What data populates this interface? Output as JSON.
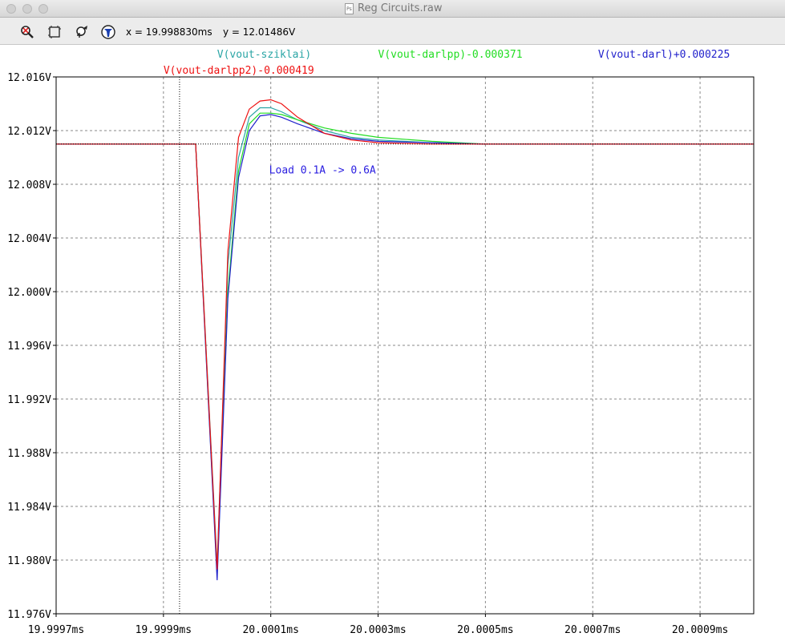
{
  "window": {
    "title": "Reg Circuits.raw",
    "file_icon": "Ps"
  },
  "toolbar": {
    "tools": [
      "zoom-out-icon",
      "zoom-full-icon",
      "pan-back-icon",
      "probe-icon"
    ],
    "cursor_x": "x = 19.998830ms",
    "cursor_y": "y = 12.01486V"
  },
  "chart_data": {
    "type": "line",
    "xlabel": "",
    "ylabel": "",
    "xlim": [
      19.9997,
      20.001
    ],
    "ylim": [
      11.976,
      12.016
    ],
    "x_ticks": [
      19.9997,
      19.9999,
      20.0001,
      20.0003,
      20.0005,
      20.0007,
      20.0009
    ],
    "x_tick_labels": [
      "19.9997ms",
      "19.9999ms",
      "20.0001ms",
      "20.0003ms",
      "20.0005ms",
      "20.0007ms",
      "20.0009ms"
    ],
    "y_ticks": [
      11.976,
      11.98,
      11.984,
      11.988,
      11.992,
      11.996,
      12.0,
      12.004,
      12.008,
      12.012,
      12.016
    ],
    "y_tick_labels": [
      "11.976V",
      "11.980V",
      "11.984V",
      "11.988V",
      "11.992V",
      "11.996V",
      "12.000V",
      "12.004V",
      "12.008V",
      "12.012V",
      "12.016V"
    ],
    "grid": true,
    "cursor": {
      "x": 19.99993,
      "y": 12.011
    },
    "annotation": {
      "text": "Load 0.1A -> 0.6A",
      "x": 20.000097,
      "y": 12.0088,
      "color": "#2a1ee0"
    },
    "series": [
      {
        "name": "V(vout-sziklai)",
        "color": "#2aa5a5",
        "legend_row": 1,
        "legend_x": 20.0,
        "x": [
          19.9997,
          19.99996,
          20.0,
          20.00002,
          20.00004,
          20.00006,
          20.00008,
          20.0001,
          20.00012,
          20.00015,
          20.0002,
          20.00025,
          20.0003,
          20.0004,
          20.0005,
          20.0006,
          20.0008,
          20.001
        ],
        "values": [
          12.011,
          12.011,
          11.9796,
          12.002,
          12.01,
          12.013,
          12.0137,
          12.0137,
          12.0134,
          12.0128,
          12.012,
          12.0115,
          12.0113,
          12.0111,
          12.011,
          12.011,
          12.011,
          12.011
        ]
      },
      {
        "name": "V(vout-darlpp)-0.000371",
        "color": "#22dd22",
        "legend_row": 1,
        "legend_x": 20.0003,
        "x": [
          19.9997,
          19.99996,
          20.0,
          20.00002,
          20.00004,
          20.00006,
          20.00008,
          20.0001,
          20.00012,
          20.00015,
          20.0002,
          20.00025,
          20.0003,
          20.0004,
          20.0005,
          20.0006,
          20.0008,
          20.001
        ],
        "values": [
          12.011,
          12.011,
          11.9788,
          12.0,
          12.009,
          12.0125,
          12.0133,
          12.0133,
          12.0132,
          12.0128,
          12.0122,
          12.0118,
          12.0115,
          12.0112,
          12.011,
          12.011,
          12.011,
          12.011
        ]
      },
      {
        "name": "V(vout-darl)+0.000225",
        "color": "#2222cc",
        "legend_row": 1,
        "legend_x": 20.00071,
        "x": [
          19.9997,
          19.99996,
          20.0,
          20.00002,
          20.00004,
          20.00006,
          20.00008,
          20.0001,
          20.00012,
          20.00015,
          20.0002,
          20.00025,
          20.0003,
          20.0004,
          20.0005,
          20.0006,
          20.0008,
          20.001
        ],
        "values": [
          12.011,
          12.011,
          11.9785,
          11.9995,
          12.0085,
          12.012,
          12.0131,
          12.0132,
          12.013,
          12.0125,
          12.0118,
          12.0114,
          12.0112,
          12.0111,
          12.011,
          12.011,
          12.011,
          12.011
        ]
      },
      {
        "name": "V(vout-darlpp2)-0.000419",
        "color": "#ee1111",
        "legend_row": 2,
        "legend_x": 19.9999,
        "x": [
          19.9997,
          19.99996,
          20.0,
          20.00002,
          20.00004,
          20.00006,
          20.00008,
          20.0001,
          20.00012,
          20.00015,
          20.0002,
          20.00025,
          20.0003,
          20.0004,
          20.0005,
          20.0006,
          20.0008,
          20.001
        ],
        "values": [
          12.011,
          12.011,
          11.9793,
          12.003,
          12.0115,
          12.0136,
          12.0142,
          12.0143,
          12.014,
          12.013,
          12.0118,
          12.0113,
          12.0111,
          12.011,
          12.011,
          12.011,
          12.011,
          12.011
        ]
      }
    ]
  }
}
